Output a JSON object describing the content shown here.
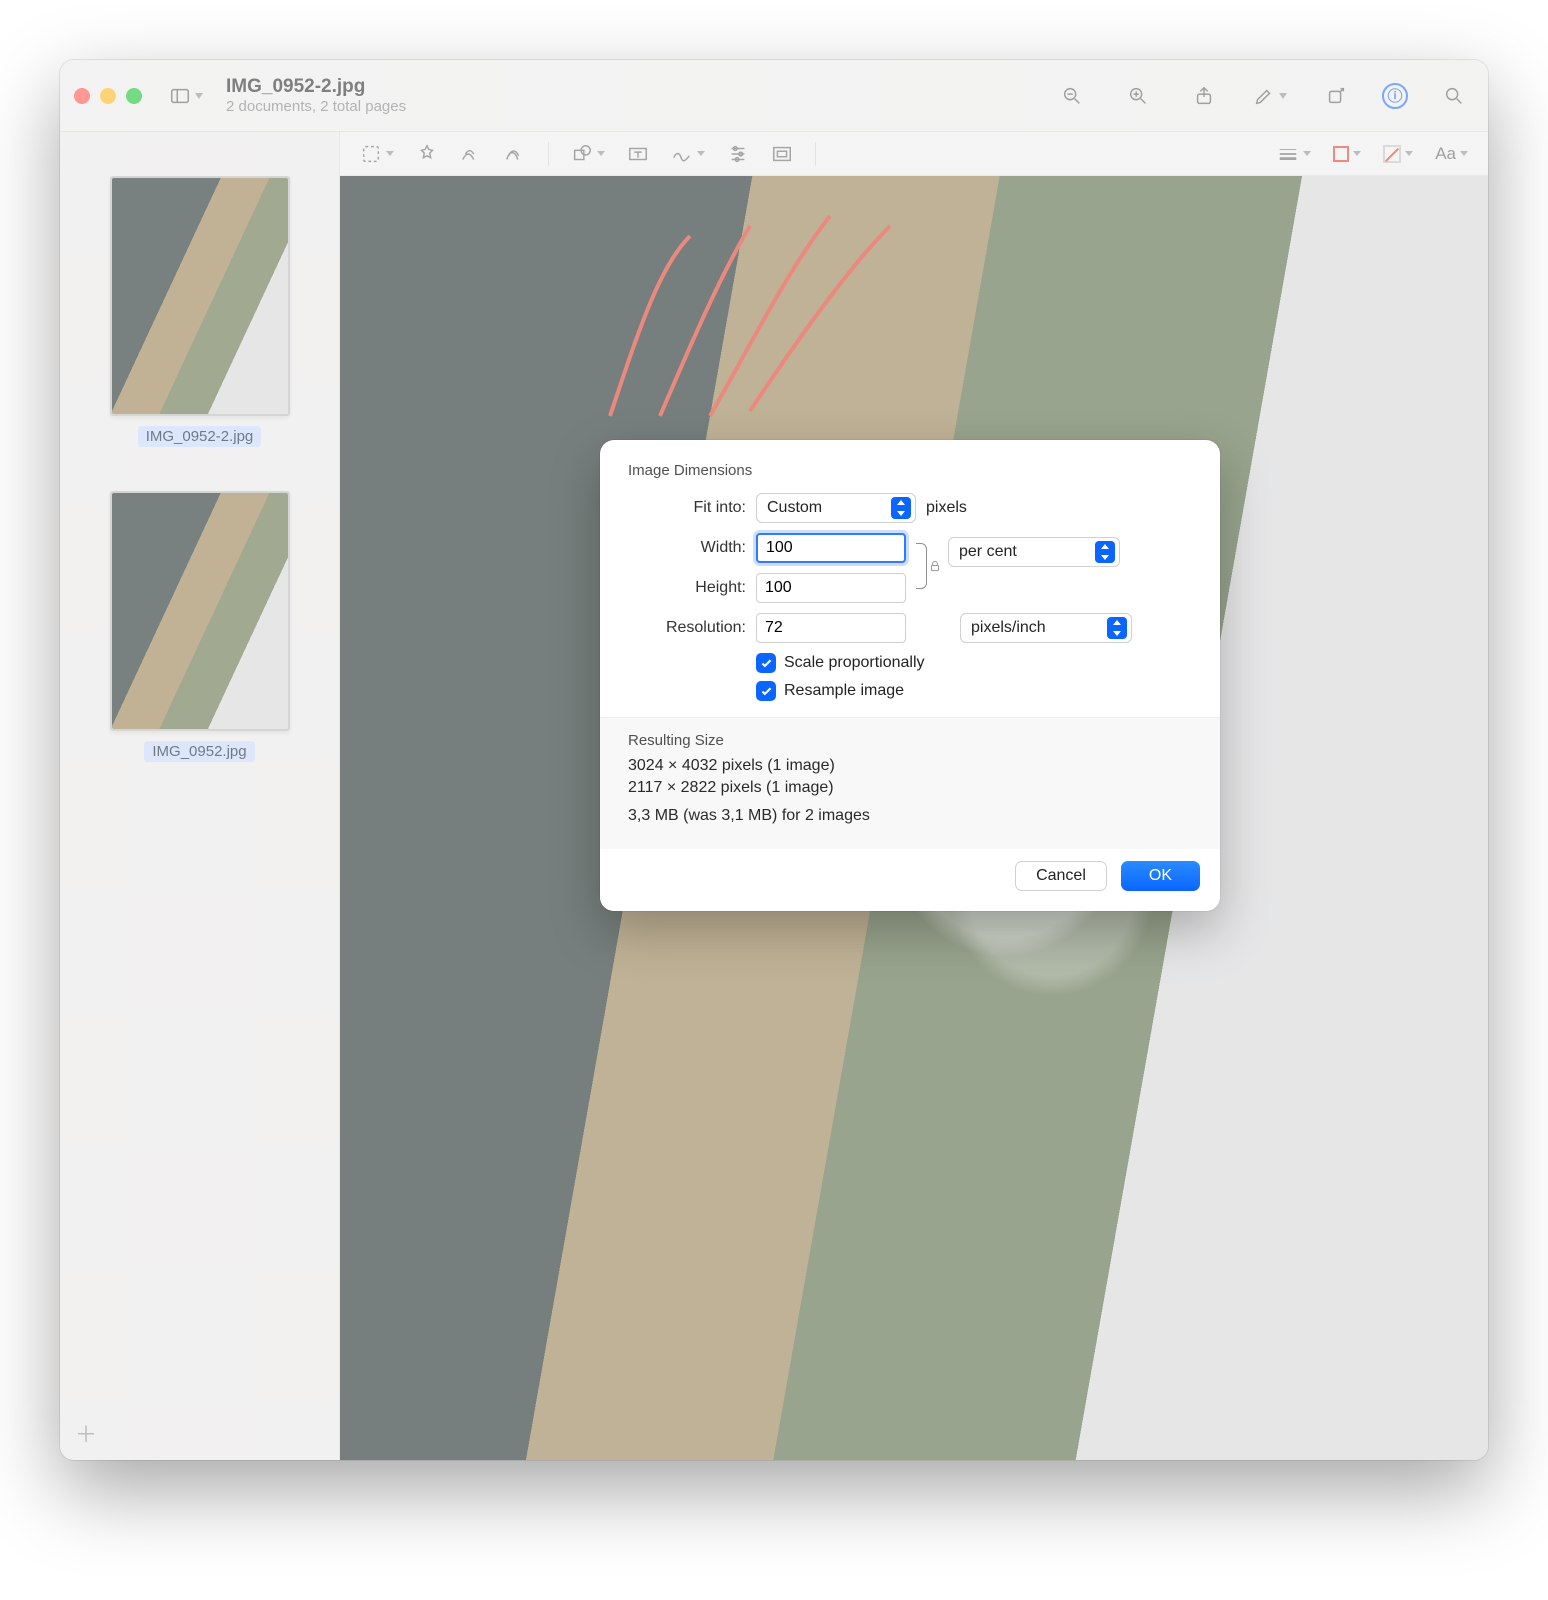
{
  "window": {
    "title": "IMG_0952-2.jpg",
    "subtitle": "2 documents, 2 total pages"
  },
  "sidebar": {
    "thumbs": [
      {
        "label": "IMG_0952-2.jpg"
      },
      {
        "label": "IMG_0952.jpg"
      }
    ]
  },
  "dialog": {
    "section_label": "Image Dimensions",
    "fit_label": "Fit into:",
    "fit_value": "Custom",
    "fit_unit_suffix": "pixels",
    "width_label": "Width:",
    "width_value": "100",
    "height_label": "Height:",
    "height_value": "100",
    "wh_unit": "per cent",
    "resolution_label": "Resolution:",
    "resolution_value": "72",
    "resolution_unit": "pixels/inch",
    "scale_checkbox": "Scale proportionally",
    "resample_checkbox": "Resample image",
    "result_label": "Resulting Size",
    "result_line1": "3024 × 4032 pixels (1 image)",
    "result_line2": "2117 × 2822 pixels (1 image)",
    "result_line3": "3,3 MB (was 3,1 MB) for 2 images",
    "cancel": "Cancel",
    "ok": "OK"
  },
  "toolbar2": {
    "text_style": "Aa"
  }
}
